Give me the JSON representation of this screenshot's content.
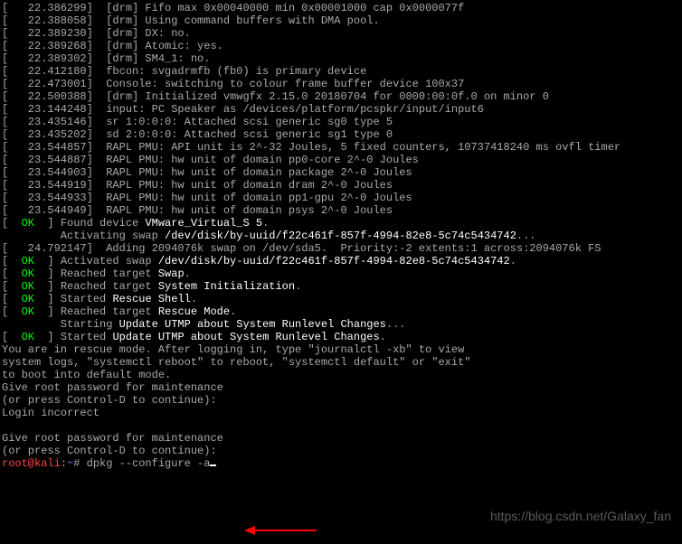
{
  "lines": [
    {
      "segments": [
        {
          "t": "[   22.386299]  [drm] Fifo max 0x00040000 min 0x00001000 cap 0x0000077f",
          "c": "gray"
        }
      ]
    },
    {
      "segments": [
        {
          "t": "[   22.388058]  [drm] Using command buffers with DMA pool.",
          "c": "gray"
        }
      ]
    },
    {
      "segments": [
        {
          "t": "[   22.389230]  [drm] DX: no.",
          "c": "gray"
        }
      ]
    },
    {
      "segments": [
        {
          "t": "[   22.389268]  [drm] Atomic: yes.",
          "c": "gray"
        }
      ]
    },
    {
      "segments": [
        {
          "t": "[   22.389302]  [drm] SM4_1: no.",
          "c": "gray"
        }
      ]
    },
    {
      "segments": [
        {
          "t": "[   22.412180]  fbcon: svgadrmfb (fb0) is primary device",
          "c": "gray"
        }
      ]
    },
    {
      "segments": [
        {
          "t": "[   22.473001]  Console: switching to colour frame buffer device 100x37",
          "c": "gray"
        }
      ]
    },
    {
      "segments": [
        {
          "t": "[   22.500388]  [drm] Initialized vmwgfx 2.15.0 20180704 for 0000:00:0f.0 on minor 0",
          "c": "gray"
        }
      ]
    },
    {
      "segments": [
        {
          "t": "[   23.144248]  input: PC Speaker as /devices/platform/pcspkr/input/input6",
          "c": "gray"
        }
      ]
    },
    {
      "segments": [
        {
          "t": "[   23.435146]  sr 1:0:0:0: Attached scsi generic sg0 type 5",
          "c": "gray"
        }
      ]
    },
    {
      "segments": [
        {
          "t": "[   23.435202]  sd 2:0:0:0: Attached scsi generic sg1 type 0",
          "c": "gray"
        }
      ]
    },
    {
      "segments": [
        {
          "t": "[   23.544857]  RAPL PMU: API unit is 2^-32 Joules, 5 fixed counters, 10737418240 ms ovfl timer",
          "c": "gray"
        }
      ]
    },
    {
      "segments": [
        {
          "t": "[   23.544887]  RAPL PMU: hw unit of domain pp0-core 2^-0 Joules",
          "c": "gray"
        }
      ]
    },
    {
      "segments": [
        {
          "t": "[   23.544903]  RAPL PMU: hw unit of domain package 2^-0 Joules",
          "c": "gray"
        }
      ]
    },
    {
      "segments": [
        {
          "t": "[   23.544919]  RAPL PMU: hw unit of domain dram 2^-0 Joules",
          "c": "gray"
        }
      ]
    },
    {
      "segments": [
        {
          "t": "[   23.544933]  RAPL PMU: hw unit of domain pp1-gpu 2^-0 Joules",
          "c": "gray"
        }
      ]
    },
    {
      "segments": [
        {
          "t": "[   23.544949]  RAPL PMU: hw unit of domain psys 2^-0 Joules",
          "c": "gray"
        }
      ]
    },
    {
      "segments": [
        {
          "t": "[  ",
          "c": "gray"
        },
        {
          "t": "OK",
          "c": "green"
        },
        {
          "t": "  ] Found device ",
          "c": "gray"
        },
        {
          "t": "VMware_Virtual_S 5",
          "c": "white"
        },
        {
          "t": ".",
          "c": "gray"
        }
      ]
    },
    {
      "segments": [
        {
          "t": "         Activating swap ",
          "c": "gray"
        },
        {
          "t": "/dev/disk/by-uuid/f22c461f-857f-4994-82e8-5c74c5434742",
          "c": "white"
        },
        {
          "t": "...",
          "c": "gray"
        }
      ]
    },
    {
      "segments": [
        {
          "t": "[   24.792147]  Adding 2094076k swap on /dev/sda5.  Priority:-2 extents:1 across:2094076k FS",
          "c": "gray"
        }
      ]
    },
    {
      "segments": [
        {
          "t": "[  ",
          "c": "gray"
        },
        {
          "t": "OK",
          "c": "green"
        },
        {
          "t": "  ] Activated swap ",
          "c": "gray"
        },
        {
          "t": "/dev/disk/by-uuid/f22c461f-857f-4994-82e8-5c74c5434742",
          "c": "white"
        },
        {
          "t": ".",
          "c": "gray"
        }
      ]
    },
    {
      "segments": [
        {
          "t": "[  ",
          "c": "gray"
        },
        {
          "t": "OK",
          "c": "green"
        },
        {
          "t": "  ] Reached target ",
          "c": "gray"
        },
        {
          "t": "Swap",
          "c": "white"
        },
        {
          "t": ".",
          "c": "gray"
        }
      ]
    },
    {
      "segments": [
        {
          "t": "[  ",
          "c": "gray"
        },
        {
          "t": "OK",
          "c": "green"
        },
        {
          "t": "  ] Reached target ",
          "c": "gray"
        },
        {
          "t": "System Initialization",
          "c": "white"
        },
        {
          "t": ".",
          "c": "gray"
        }
      ]
    },
    {
      "segments": [
        {
          "t": "[  ",
          "c": "gray"
        },
        {
          "t": "OK",
          "c": "green"
        },
        {
          "t": "  ] Started ",
          "c": "gray"
        },
        {
          "t": "Rescue Shell",
          "c": "white"
        },
        {
          "t": ".",
          "c": "gray"
        }
      ]
    },
    {
      "segments": [
        {
          "t": "[  ",
          "c": "gray"
        },
        {
          "t": "OK",
          "c": "green"
        },
        {
          "t": "  ] Reached target ",
          "c": "gray"
        },
        {
          "t": "Rescue Mode",
          "c": "white"
        },
        {
          "t": ".",
          "c": "gray"
        }
      ]
    },
    {
      "segments": [
        {
          "t": "         Starting ",
          "c": "gray"
        },
        {
          "t": "Update UTMP about System Runlevel Changes",
          "c": "white"
        },
        {
          "t": "...",
          "c": "gray"
        }
      ]
    },
    {
      "segments": [
        {
          "t": "[  ",
          "c": "gray"
        },
        {
          "t": "OK",
          "c": "green"
        },
        {
          "t": "  ] Started ",
          "c": "gray"
        },
        {
          "t": "Update UTMP about System Runlevel Changes",
          "c": "white"
        },
        {
          "t": ".",
          "c": "gray"
        }
      ]
    },
    {
      "segments": [
        {
          "t": "You are in rescue mode. After logging in, type \"journalctl -xb\" to view",
          "c": "gray"
        }
      ]
    },
    {
      "segments": [
        {
          "t": "system logs, \"systemctl reboot\" to reboot, \"systemctl default\" or \"exit\"",
          "c": "gray"
        }
      ]
    },
    {
      "segments": [
        {
          "t": "to boot into default mode.",
          "c": "gray"
        }
      ]
    },
    {
      "segments": [
        {
          "t": "Give root password for maintenance",
          "c": "gray"
        }
      ]
    },
    {
      "segments": [
        {
          "t": "(or press Control-D to continue): ",
          "c": "gray"
        }
      ]
    },
    {
      "segments": [
        {
          "t": "Login incorrect",
          "c": "gray"
        }
      ]
    },
    {
      "segments": [
        {
          "t": " ",
          "c": "gray"
        }
      ]
    },
    {
      "segments": [
        {
          "t": "Give root password for maintenance",
          "c": "gray"
        }
      ]
    },
    {
      "segments": [
        {
          "t": "(or press Control-D to continue): ",
          "c": "gray"
        }
      ]
    }
  ],
  "prompt": {
    "user_host": "root@kali",
    "sep": ":",
    "path": "~",
    "hash": "# ",
    "command": "dpkg --configure -a"
  },
  "watermark": "https://blog.csdn.net/Galaxy_fan"
}
